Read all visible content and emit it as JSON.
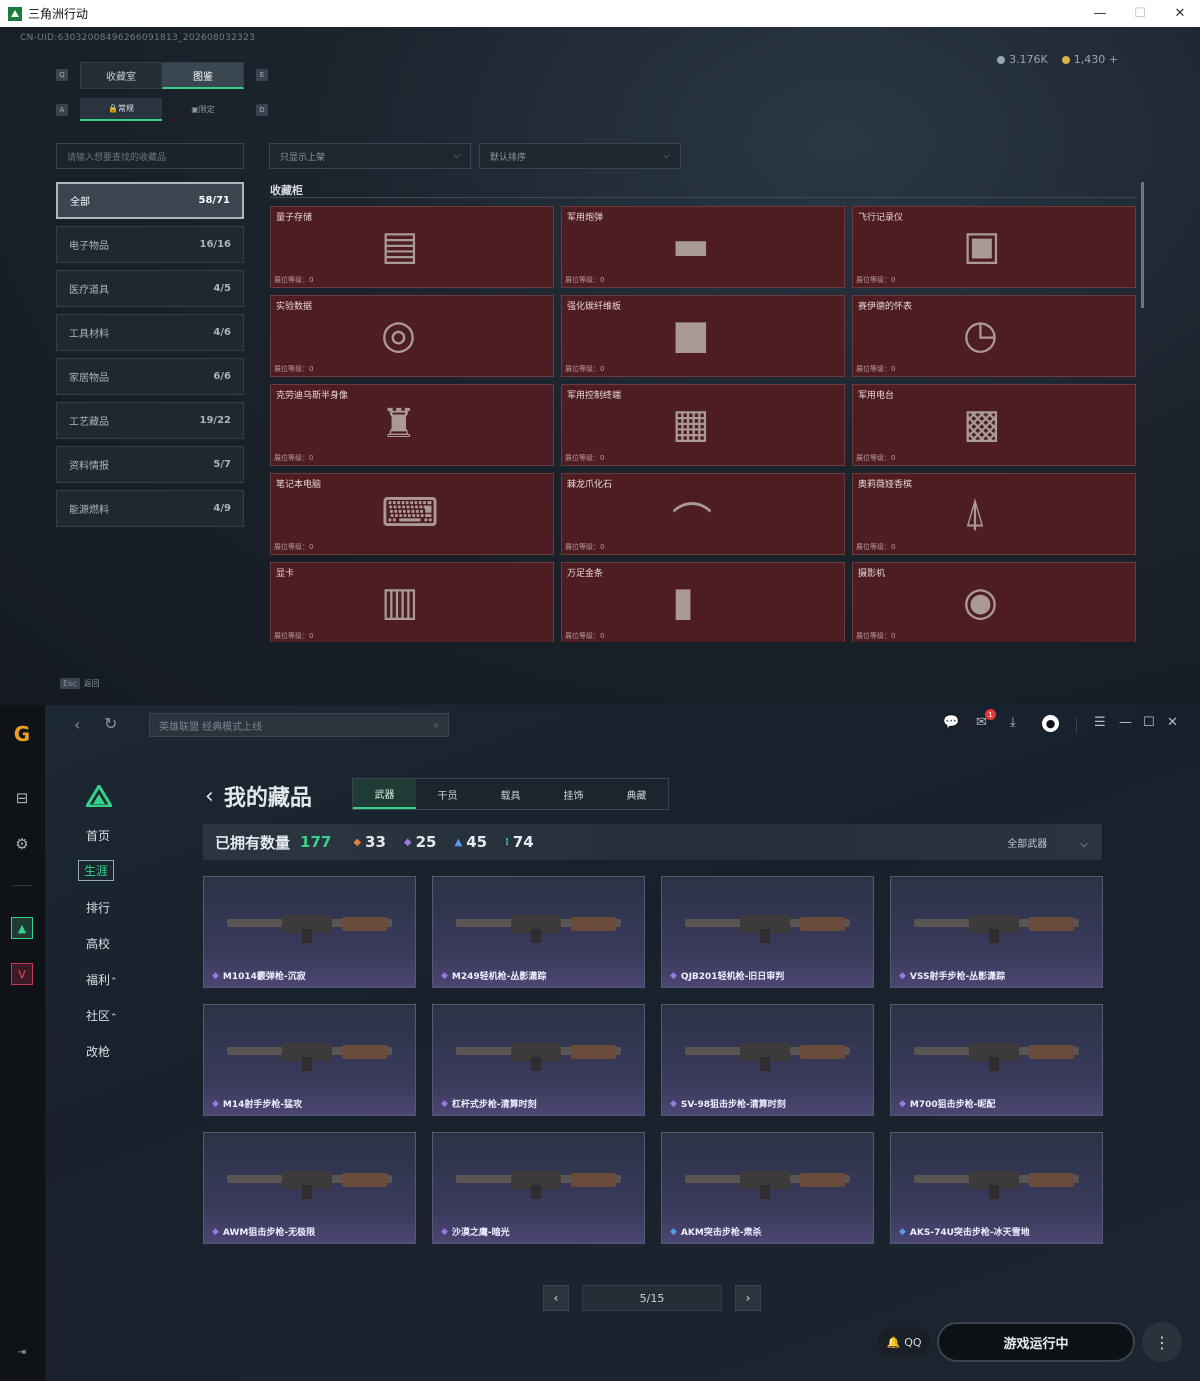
{
  "window": {
    "title": "三角洲行动",
    "uid": "CN-UID:63032008496266091813_202608032323",
    "currency": [
      "3.176K",
      "1,430"
    ],
    "keyhints": [
      "Q",
      "E",
      "A",
      "D"
    ],
    "tabs": [
      "收藏室",
      "图鉴"
    ],
    "subtabs": [
      "常规",
      "限定"
    ],
    "search_placeholder": "请输入想要查找的收藏品",
    "filter1": "只显示上架",
    "filter2": "默认排序",
    "categories": [
      {
        "label": "全部",
        "count": "58/71"
      },
      {
        "label": "电子物品",
        "count": "16/16"
      },
      {
        "label": "医疗道具",
        "count": "4/5"
      },
      {
        "label": "工具材料",
        "count": "4/6"
      },
      {
        "label": "家居物品",
        "count": "6/6"
      },
      {
        "label": "工艺藏品",
        "count": "19/22"
      },
      {
        "label": "资料情报",
        "count": "5/7"
      },
      {
        "label": "能源燃料",
        "count": "4/9"
      }
    ],
    "section_title": "收藏柜",
    "level_label": "展位等级：0",
    "items": [
      "量子存储",
      "军用炮弹",
      "飞行记录仪",
      "实验数据",
      "强化碳纤维板",
      "赛伊德的怀表",
      "克劳迪乌斯半身像",
      "军用控制终端",
      "军用电台",
      "笔记本电脑",
      "棘龙爪化石",
      "奥莉薇娅香槟",
      "显卡",
      "万足金条",
      "摄影机"
    ],
    "esc_key": "Esc",
    "esc_label": "返回"
  },
  "launcher": {
    "search_placeholder": "英雄联盟 经典模式上线",
    "mail_badge": "1",
    "nav": [
      "首页",
      "生涯",
      "排行",
      "高校",
      "福利",
      "社区",
      "改枪"
    ],
    "page_title": "我的藏品",
    "tabs": [
      "武器",
      "干员",
      "载具",
      "挂饰",
      "典藏"
    ],
    "owned_label": "已拥有数量",
    "owned_count": "177",
    "stats": [
      "33",
      "25",
      "45",
      "74"
    ],
    "filter": "全部武器",
    "weapons": [
      "M1014霰弹枪-沉寂",
      "M249轻机枪-丛影潇踪",
      "QJB201轻机枪-旧日审判",
      "VSS射手步枪-丛影潇踪",
      "M14射手步枪-猛攻",
      "杠杆式步枪-清算时刻",
      "SV-98狙击步枪-清算时刻",
      "M700狙击步枪-昵配",
      "AWM狙击步枪-无极限",
      "沙漠之鹰-暗光",
      "AKM突击步枪-肃杀",
      "AKS-74U突击步枪-冰天雪地"
    ],
    "page": "5/15",
    "qq": "QQ",
    "run_button": "游戏运行中",
    "colors": {
      "accent": "#34d189",
      "item_bg": "#4e1d22",
      "stat_orange": "#e0803a",
      "stat_purple": "#9a7ae0",
      "stat_blue": "#5a9ae8",
      "stat_green": "#3bd18d"
    }
  }
}
